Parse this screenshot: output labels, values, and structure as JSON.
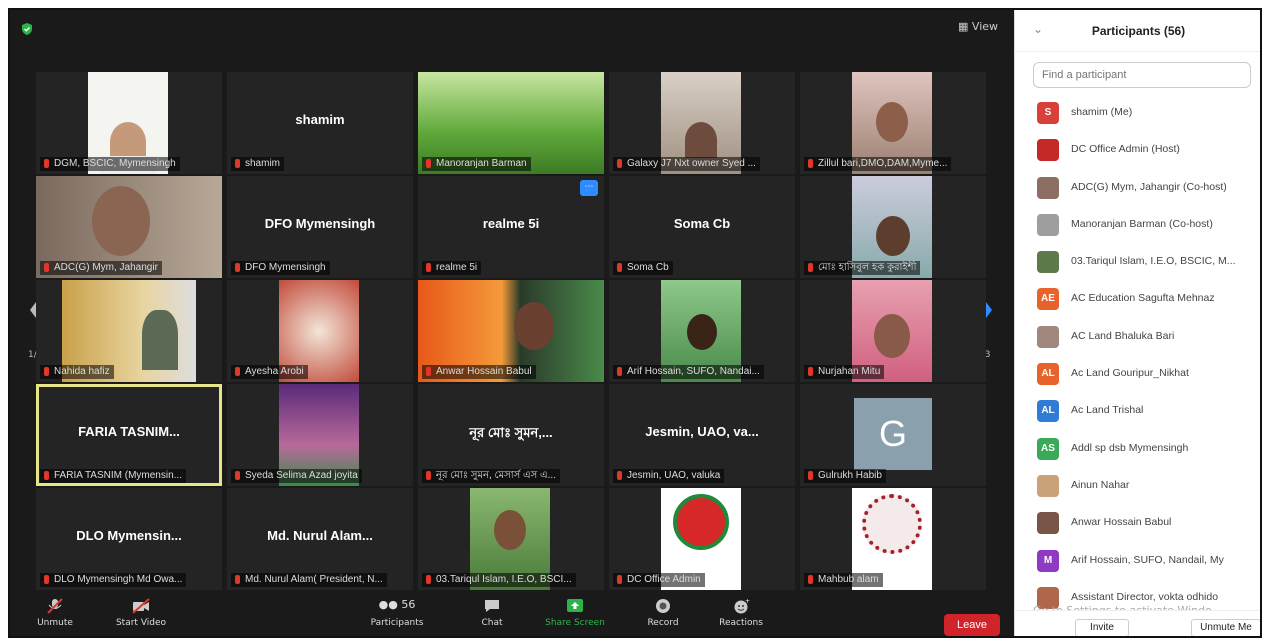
{
  "meeting": {
    "view_label": "View",
    "page_left": "1/3",
    "page_right": "1/3",
    "tiles": [
      {
        "name": "DGM, BSCIC, Mymensingh",
        "big": "",
        "video": "person-white"
      },
      {
        "name": "shamim",
        "big": "shamim",
        "video": ""
      },
      {
        "name": "Manoranjan Barman",
        "big": "",
        "video": "grass"
      },
      {
        "name": "Galaxy J7 Nxt owner Syed ...",
        "big": "",
        "video": "office"
      },
      {
        "name": "Zillul bari,DMO,DAM,Myme...",
        "big": "",
        "video": "office2"
      },
      {
        "name": "ADC(G) Mym, Jahangir",
        "big": "",
        "video": "man-room"
      },
      {
        "name": "DFO Mymensingh",
        "big": "DFO Mymensingh",
        "video": ""
      },
      {
        "name": "realme 5i",
        "big": "realme 5i",
        "video": ""
      },
      {
        "name": "Soma Cb",
        "big": "Soma Cb",
        "video": ""
      },
      {
        "name": "মোঃ হাসিবুল হক কুরাইশী",
        "big": "",
        "video": "man-sky"
      },
      {
        "name": "Nahida hafiz",
        "big": "",
        "video": "gold"
      },
      {
        "name": "Ayesha Arobi",
        "big": "",
        "video": "flowers"
      },
      {
        "name": "Anwar Hossain Babul",
        "big": "",
        "video": "orange"
      },
      {
        "name": "Arif Hossain, SUFO, Nandai...",
        "big": "",
        "video": "man-green"
      },
      {
        "name": "Nurjahan Mitu",
        "big": "",
        "video": "woman"
      },
      {
        "name": "FARIA TASNIM (Mymensin...",
        "big": "FARIA TASNIM...",
        "video": ""
      },
      {
        "name": "Syeda Selima Azad joyita",
        "big": "",
        "video": "stage"
      },
      {
        "name": "নূর মোঃ সুমন, মেসার্স এস এ...",
        "big": "নূর মোঃ সুমন,...",
        "video": ""
      },
      {
        "name": "Jesmin, UAO, valuka",
        "big": "Jesmin, UAO, va...",
        "video": ""
      },
      {
        "name": "Gulrukh Habib",
        "big": "",
        "video": "G"
      },
      {
        "name": "DLO Mymensingh Md Owa...",
        "big": "DLO Mymensin...",
        "video": ""
      },
      {
        "name": "Md. Nurul Alam( President, N...",
        "big": "Md. Nurul Alam...",
        "video": ""
      },
      {
        "name": "03.Tariqul Islam, I.E.O, BSCI...",
        "big": "",
        "video": "man-field"
      },
      {
        "name": "DC Office Admin",
        "big": "",
        "video": "logo-bd"
      },
      {
        "name": "Mahbub alam",
        "big": "",
        "video": "logo-seal"
      }
    ]
  },
  "toolbar": {
    "unmute": "Unmute",
    "start_video": "Start Video",
    "participants": "Participants",
    "participants_count": "56",
    "chat": "Chat",
    "share": "Share Screen",
    "record": "Record",
    "reactions": "Reactions",
    "leave": "Leave"
  },
  "panel": {
    "title": "Participants (56)",
    "search_placeholder": "Find a participant",
    "participants": [
      {
        "initials": "S",
        "name": "shamim (Me)",
        "color": "#d9403a"
      },
      {
        "initials": "",
        "name": "DC Office Admin (Host)",
        "color": "#c62828"
      },
      {
        "initials": "",
        "name": "ADC(G) Mym, Jahangir (Co-host)",
        "color": "#8d6e63"
      },
      {
        "initials": "",
        "name": "Manoranjan Barman (Co-host)",
        "color": "#9e9e9e"
      },
      {
        "initials": "",
        "name": "03.Tariqul Islam, I.E.O, BSCIC, M...",
        "color": "#5d7a4a"
      },
      {
        "initials": "AE",
        "name": "AC Education Sagufta Mehnaz",
        "color": "#e8632b"
      },
      {
        "initials": "",
        "name": "AC Land Bhaluka Bari",
        "color": "#a1887f"
      },
      {
        "initials": "AL",
        "name": "Ac Land Gouripur_Nikhat",
        "color": "#e8632b"
      },
      {
        "initials": "AL",
        "name": "Ac Land Trishal",
        "color": "#2f7bd6"
      },
      {
        "initials": "AS",
        "name": "Addl sp dsb Mymensingh",
        "color": "#3aaa5a"
      },
      {
        "initials": "",
        "name": "Ainun Nahar",
        "color": "#c9a27a"
      },
      {
        "initials": "",
        "name": "Anwar Hossain Babul",
        "color": "#795548"
      },
      {
        "initials": "M",
        "name": "Arif Hossain, SUFO, Nandail, My",
        "color": "#8e3ac2"
      },
      {
        "initials": "",
        "name": "Assistant Director, vokta odhido",
        "color": "#b0664a"
      }
    ],
    "watermark": "Go to Settings to activate Windo",
    "invite": "Invite",
    "unmute_me": "Unmute Me"
  }
}
